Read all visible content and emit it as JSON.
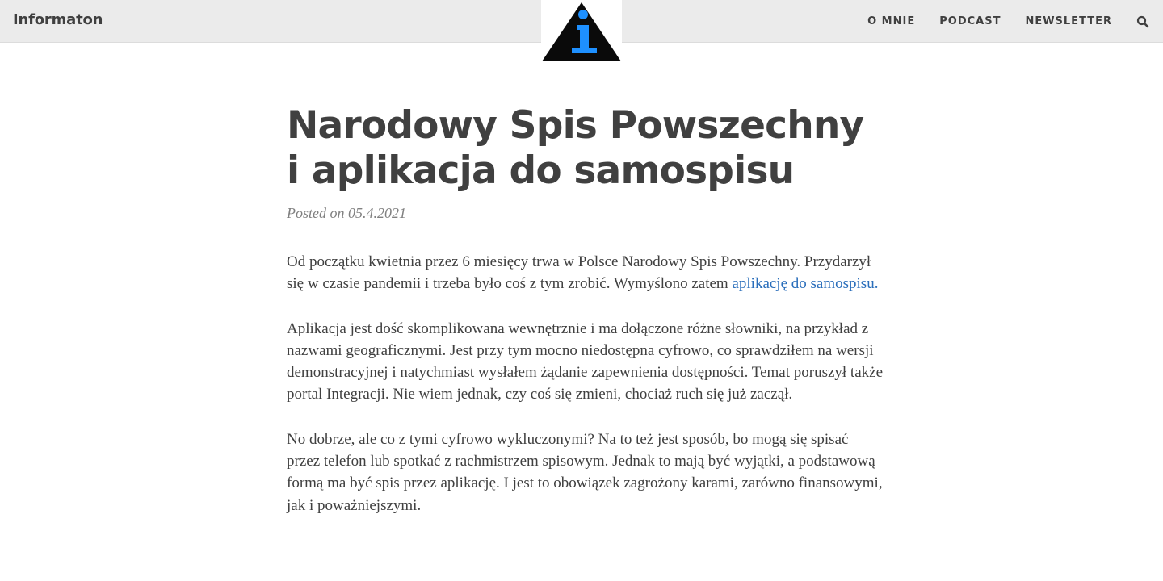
{
  "nav": {
    "brand": "Informaton",
    "links": [
      "O MNIE",
      "PODCAST",
      "NEWSLETTER"
    ],
    "search_icon": "search-icon",
    "logo_icon": "info-triangle-icon"
  },
  "post": {
    "title_line1": "Narodowy Spis Powszechny",
    "title_line2": "i aplikacja do samospisu",
    "meta": "Posted on 05.4.2021",
    "p1_before": "Od początku kwietnia przez 6 miesięcy trwa w Polsce Narodowy Spis Powszechny. Przydarzył się w czasie pandemii i trzeba było coś z tym zrobić. Wymyślono zatem ",
    "p1_link": "aplikację do samospisu.",
    "p2": "Aplikacja jest dość skomplikowana wewnętrznie i ma dołączone różne słowniki, na przykład z nazwami geograficznymi. Jest przy tym mocno niedostępna cyfrowo, co sprawdziłem na wersji demonstracyjnej i natychmiast wysłałem żądanie zapewnienia dostępności. Temat poruszył także portal Integracji. Nie wiem jednak, czy coś się zmieni, chociaż ruch się już zaczął.",
    "p3": "No dobrze, ale co z tymi cyfrowo wykluczonymi? Na to też jest sposób, bo mogą się spisać przez telefon lub spotkać z rachmistrzem spisowym. Jednak to mają być wyjątki, a podstawową formą ma być spis przez aplikację. I jest to obowiązek zagrożony karami, zarówno finansowymi, jak i poważniejszymi."
  },
  "colors": {
    "navbar_bg": "#ebebeb",
    "text": "#404040",
    "link": "#2a6ebb",
    "logo_accent": "#1e90ff"
  }
}
